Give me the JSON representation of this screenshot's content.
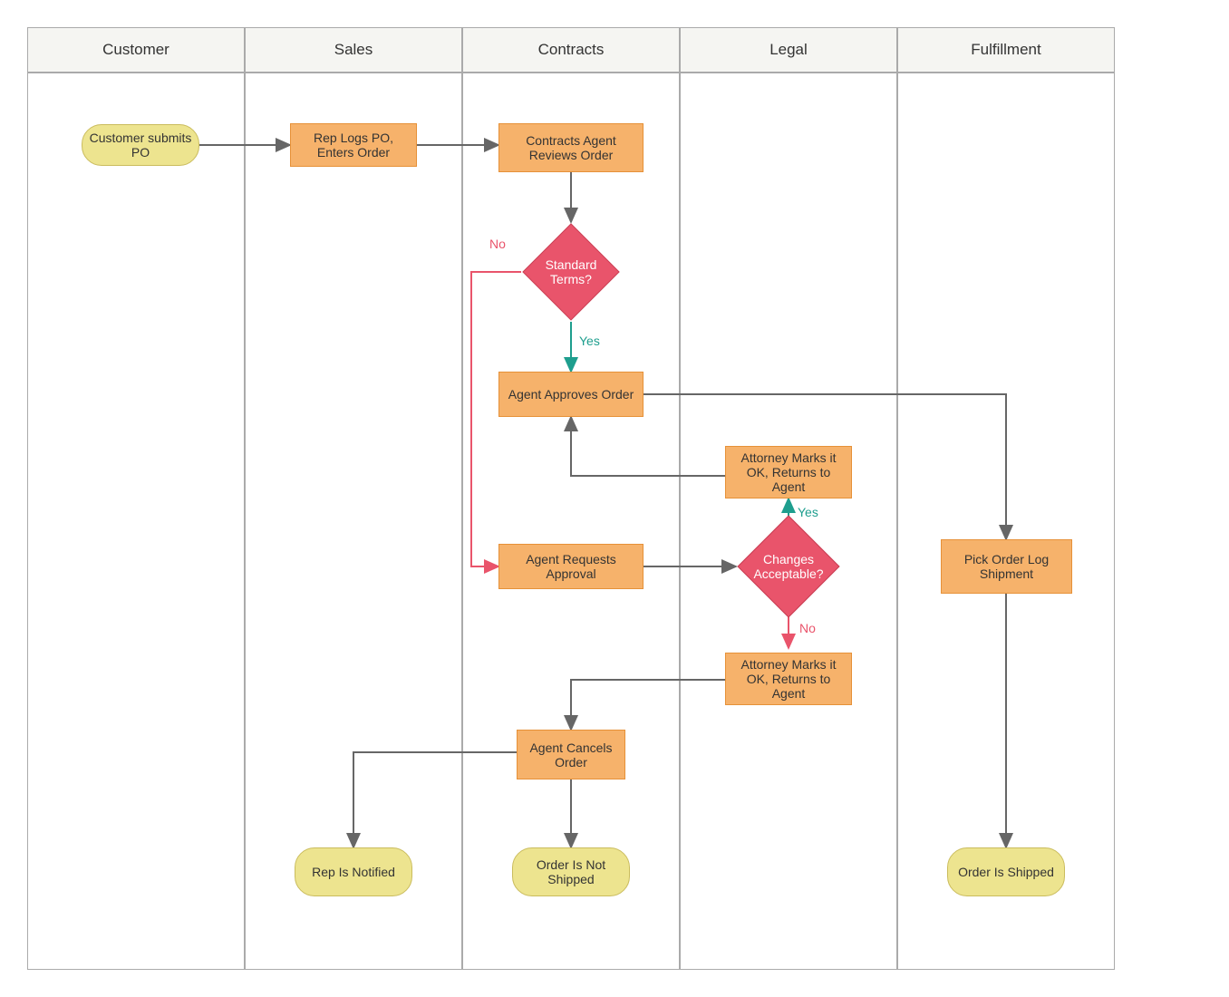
{
  "lanes": {
    "customer": "Customer",
    "sales": "Sales",
    "contracts": "Contracts",
    "legal": "Legal",
    "fulfillment": "Fulfillment"
  },
  "nodes": {
    "customer_submits_po": "Customer submits PO",
    "rep_logs_po": "Rep Logs PO, Enters Order",
    "contracts_reviews": "Contracts Agent Reviews Order",
    "standard_terms": "Standard Terms?",
    "agent_approves": "Agent Approves Order",
    "attorney_ok_returns": "Attorney Marks it OK, Returns to Agent",
    "agent_requests_approval": "Agent Requests Approval",
    "changes_acceptable": "Changes Acceptable?",
    "pick_order": "Pick Order Log Shipment",
    "attorney_ok_returns_2": "Attorney Marks it OK, Returns to Agent",
    "agent_cancels": "Agent Cancels Order",
    "rep_notified": "Rep Is Notified",
    "order_not_shipped": "Order Is Not Shipped",
    "order_shipped": "Order Is Shipped"
  },
  "labels": {
    "no": "No",
    "yes": "Yes"
  },
  "colors": {
    "arrow_gray": "#666666",
    "arrow_red": "#e9546b",
    "arrow_teal": "#1e9e8e"
  }
}
